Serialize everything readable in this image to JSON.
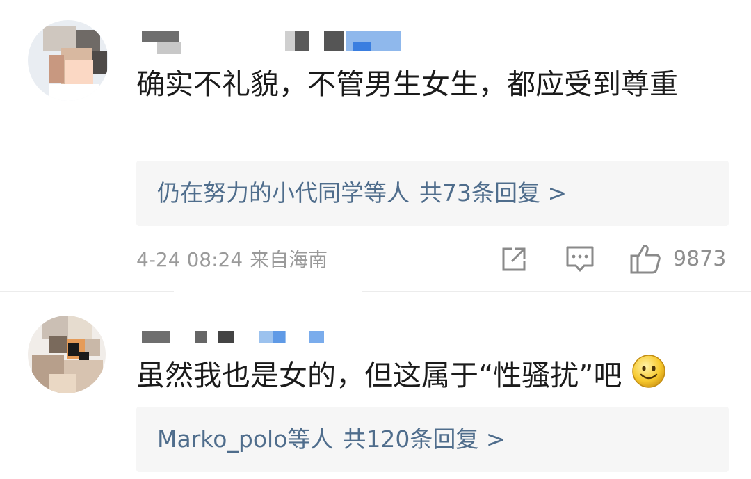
{
  "comments": [
    {
      "text": "确实不礼貌，不管男生女生，都应受到尊重",
      "reply_preview": {
        "users": "仍在努力的小代同学等人",
        "count_text": "共73条回复 >"
      },
      "timestamp": "4-24 08:24",
      "location": "来自海南",
      "likes": "9873"
    },
    {
      "text": "虽然我也是女的，但这属于“性骚扰”吧",
      "emoji": "smile-emoji",
      "reply_preview": {
        "users": "Marko_polo等人",
        "count_text": "共120条回复 >"
      }
    }
  ],
  "colors": {
    "link": "#4f6d8c",
    "meta": "#9a9a9a",
    "reply_bg": "#f6f6f6"
  },
  "icons": [
    "share-icon",
    "comment-icon",
    "like-icon"
  ]
}
